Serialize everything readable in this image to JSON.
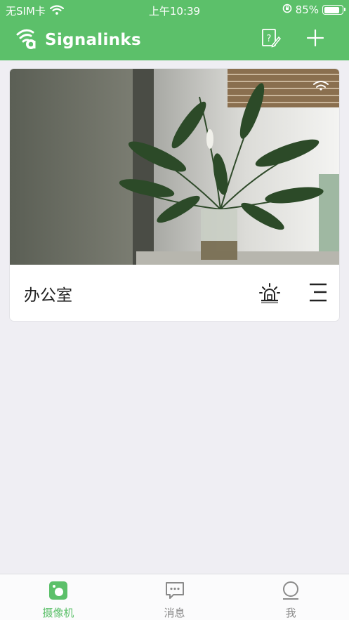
{
  "status_bar": {
    "carrier": "无SIM卡",
    "time": "上午10:39",
    "battery": "85%",
    "battery_level": 0.85
  },
  "header": {
    "brand": "Signalinks",
    "icons": [
      "help-edit-icon",
      "add-icon"
    ]
  },
  "cameras": [
    {
      "name": "办公室",
      "actions": [
        "alarm-icon",
        "menu-icon"
      ]
    }
  ],
  "tabs": [
    {
      "label": "摄像机",
      "icon": "camera-tab-icon",
      "active": true
    },
    {
      "label": "消息",
      "icon": "message-icon",
      "active": false
    },
    {
      "label": "我",
      "icon": "profile-icon",
      "active": false
    }
  ],
  "colors": {
    "accent": "#5cc06a",
    "background": "#efeef3",
    "tab_inactive": "#8a8a8a"
  }
}
